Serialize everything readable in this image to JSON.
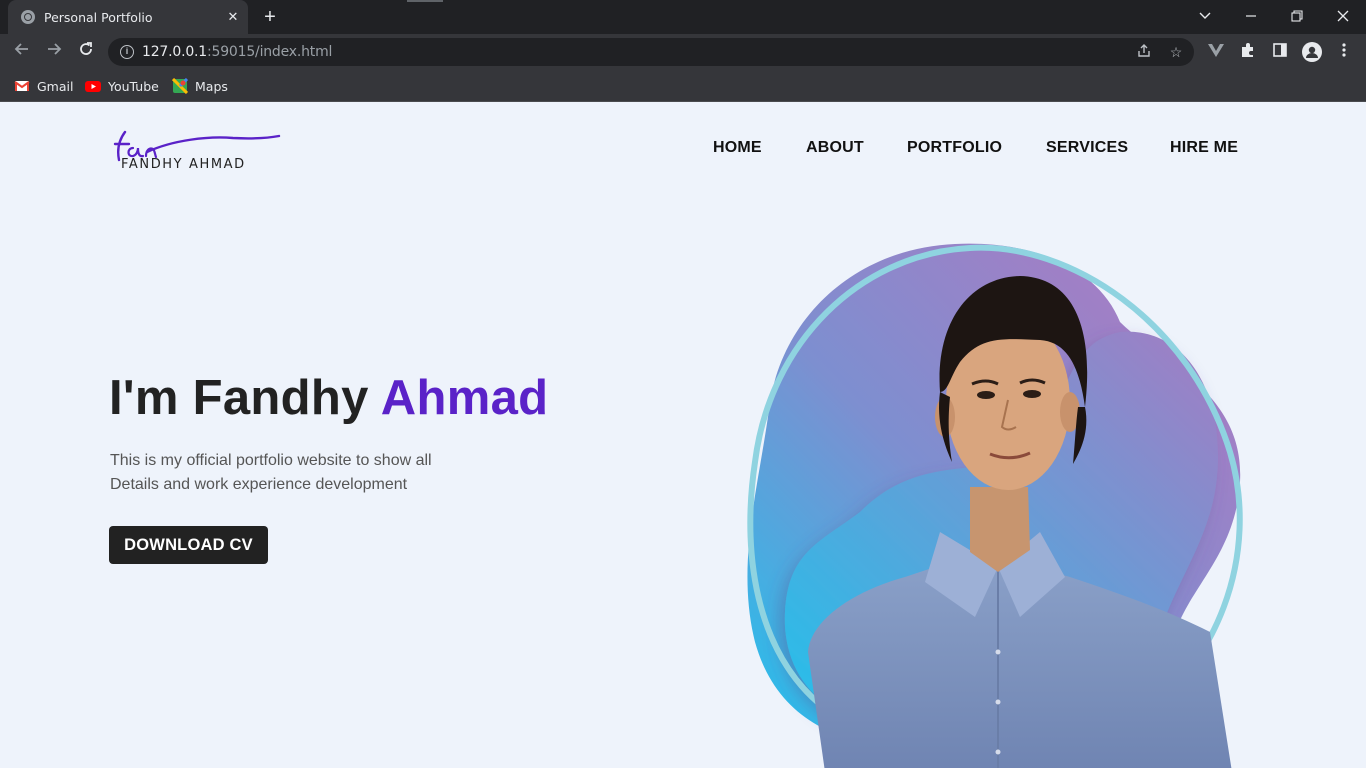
{
  "browser": {
    "tab_title": "Personal Portfolio",
    "url_host": "127.0.0.1",
    "url_rest": ":59015/index.html",
    "bookmarks": [
      {
        "label": "Gmail",
        "icon": "gmail-icon"
      },
      {
        "label": "YouTube",
        "icon": "youtube-icon"
      },
      {
        "label": "Maps",
        "icon": "maps-icon"
      }
    ]
  },
  "site": {
    "logo_script": "fan",
    "logo_name": "FANDHY AHMAD",
    "nav": [
      "HOME",
      "ABOUT",
      "PORTFOLIO",
      "SERVICES",
      "HIRE ME"
    ],
    "hero": {
      "title_prefix": "I'm Fandhy ",
      "title_accent": "Ahmad",
      "desc_line1": "This is my official portfolio website to show all",
      "desc_line2": "Details and work experience development",
      "cta": "DOWNLOAD CV"
    },
    "colors": {
      "accent": "#5a22c8",
      "button": "#222222",
      "background": "#eef3fb"
    }
  }
}
